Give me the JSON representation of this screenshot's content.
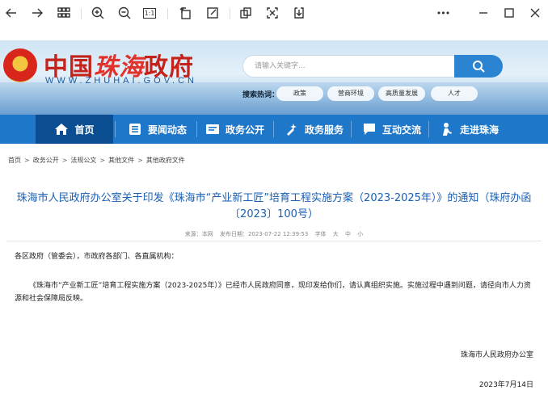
{
  "toolbar": {
    "icons": [
      "back-arrow-icon",
      "forward-arrow-icon",
      "grid-view-icon",
      "zoom-in-icon",
      "zoom-out-icon",
      "actual-size-icon",
      "rotate-icon",
      "edit-icon",
      "copy-page-icon",
      "fit-screen-icon",
      "download-icon",
      "more-icon",
      "minimize-icon",
      "maximize-icon",
      "close-icon"
    ],
    "actual_size_label": "1:1",
    "more_label": "•••"
  },
  "header": {
    "logo_text_1": "中国",
    "logo_text_2": "珠海",
    "logo_text_3": "政府",
    "logo_url": "WWW.ZHUHAI.GOV.CN",
    "search_placeholder": "请输入关键字...",
    "hot_label": "搜索热词：",
    "hot_tags": [
      "政策",
      "营商环境",
      "高质量发展",
      "人才"
    ]
  },
  "nav": {
    "items": [
      {
        "label": "首页",
        "icon": "home-icon"
      },
      {
        "label": "要闻动态",
        "icon": "news-icon"
      },
      {
        "label": "政务公开",
        "icon": "list-icon"
      },
      {
        "label": "政务服务",
        "icon": "service-icon"
      },
      {
        "label": "互动交流",
        "icon": "chat-icon"
      },
      {
        "label": "走进珠海",
        "icon": "person-icon"
      }
    ]
  },
  "breadcrumb": [
    "首页",
    "政务公开",
    "法规公文",
    "其他文件",
    "其他政府文件"
  ],
  "breadcrumb_sep": ">",
  "article": {
    "title": "珠海市人民政府办公室关于印发《珠海市“产业新工匠”培育工程实施方案（2023-2025年）》的通知（珠府办函〔2023〕100号）",
    "meta_source": "来源：本网",
    "meta_date": "发布日期：2023-07-22 12:39:53",
    "meta_font": "字体",
    "meta_large": "大",
    "meta_medium": "中",
    "meta_small": "小",
    "salutation": "各区政府（管委会），市政府各部门、各直属机构：",
    "body": "《珠海市“产业新工匠”培育工程实施方案（2023-2025年）》已经市人民政府同意，现印发给你们，请认真组织实施。实施过程中遇到问题，请径向市人力资源和社会保障局反映。",
    "signature": "珠海市人民政府办公室",
    "date": "2023年7月14日"
  },
  "colors": {
    "brand_blue": "#1f77c9",
    "nav_active": "#0b4f92",
    "title_blue": "#1a5fb4",
    "logo_red": "#c3231b"
  }
}
